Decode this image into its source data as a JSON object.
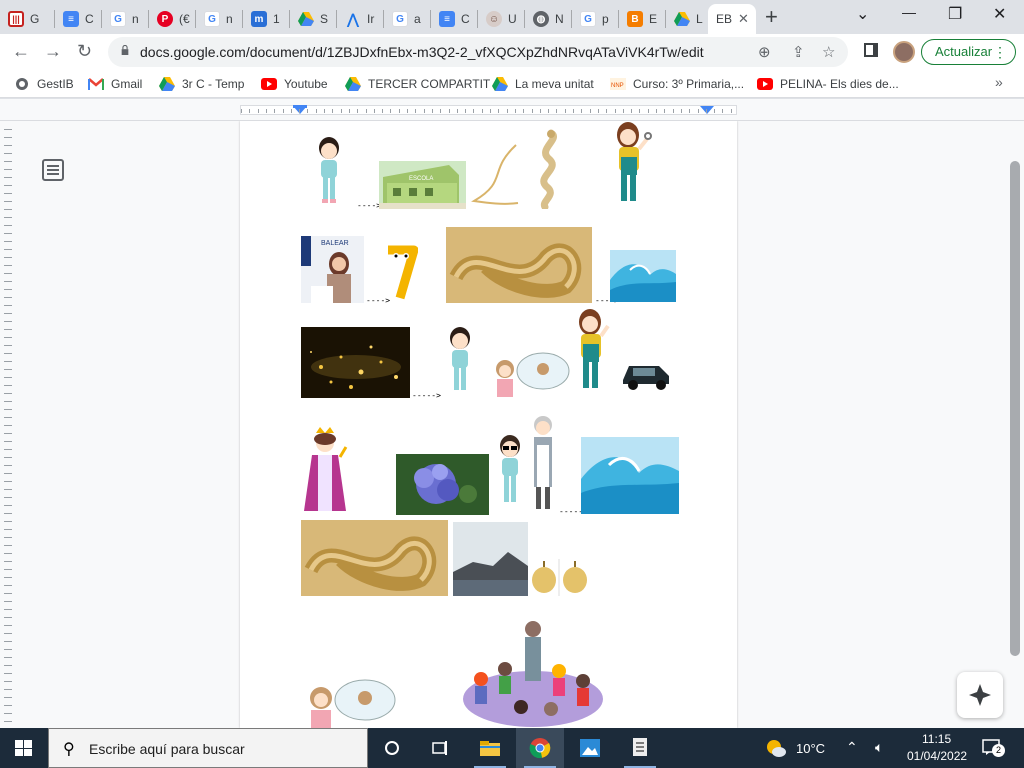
{
  "browser": {
    "tabs": [
      {
        "label": "G",
        "icon": "gestib-icon",
        "color": "#c5221f"
      },
      {
        "label": "C",
        "icon": "docs-icon",
        "color": "#4285f4"
      },
      {
        "label": "n",
        "icon": "google-icon",
        "color": "#4285f4"
      },
      {
        "label": "(€",
        "icon": "pinterest-icon",
        "color": "#e60023"
      },
      {
        "label": "n",
        "icon": "google-icon",
        "color": "#4285f4"
      },
      {
        "label": "1",
        "icon": "moodle-icon",
        "color": "#2a6fd6"
      },
      {
        "label": "S",
        "icon": "drive-icon",
        "color": "#0f9d58"
      },
      {
        "label": "Ir",
        "icon": "prism-icon",
        "color": "#1a73e8"
      },
      {
        "label": "a",
        "icon": "google-icon",
        "color": "#4285f4"
      },
      {
        "label": "C",
        "icon": "docs-icon",
        "color": "#4285f4"
      },
      {
        "label": "U",
        "icon": "avatar-icon",
        "color": "#9e7a5b"
      },
      {
        "label": "N",
        "icon": "globe-icon",
        "color": "#5f6368"
      },
      {
        "label": "p",
        "icon": "google-icon",
        "color": "#4285f4"
      },
      {
        "label": "E",
        "icon": "blogger-icon",
        "color": "#f57d00"
      },
      {
        "label": "L",
        "icon": "drive-icon",
        "color": "#0f9d58"
      },
      {
        "label": "EB",
        "icon": "docs-icon",
        "color": "#4285f4",
        "active": true
      }
    ],
    "new_tab_symbol": "+",
    "window_controls": {
      "minimize": "⌄",
      "restore": "—",
      "maximize": "❐",
      "close": "✕"
    },
    "url": "docs.google.com/document/d/1ZBJDxfnEbx-m3Q2-2_vfXQCXpZhdNRvqATaViVK4rTw/edit",
    "update_button": "Actualizar",
    "bookmarks": [
      {
        "label": "GestIB",
        "icon": "globe-icon"
      },
      {
        "label": "Gmail",
        "icon": "gmail-icon"
      },
      {
        "label": "3r C - Temp",
        "icon": "drive-icon"
      },
      {
        "label": "Youtube",
        "icon": "youtube-icon"
      },
      {
        "label": "TERCER COMPARTIT",
        "icon": "drive-icon"
      },
      {
        "label": "La meva unitat",
        "icon": "drive-icon"
      },
      {
        "label": "Curso: 3º Primaria,...",
        "icon": "course-icon"
      },
      {
        "label": "PELINA- Els dies de...",
        "icon": "youtube-icon"
      }
    ],
    "bookmarks_more": "»"
  },
  "document": {
    "arrow_text": "---->",
    "arrow_text_long": "----->",
    "images": [
      "girl-icon",
      "school-icon",
      "thread-icon",
      "snake-icon",
      "mechanic-icon",
      "speaker-icon",
      "number-seven-icon",
      "snake-photo",
      "wave-icon",
      "sparkles-photo",
      "girl-icon",
      "thinking-girl-icon",
      "mechanic-icon",
      "car-icon",
      "queen-icon",
      "hydrangea-photo",
      "girl-sunglasses-icon",
      "grandma-icon",
      "wave-icon",
      "snake-photo",
      "island-photo",
      "onion-photo",
      "thinking-girl-icon",
      "teacher-class-icon"
    ],
    "banner_text": "BALEAR",
    "school_sign": "ESCOLA"
  },
  "taskbar": {
    "search_placeholder": "Escribe aquí para buscar",
    "weather": "10°C",
    "time": "11:15",
    "date": "01/04/2022",
    "notifications": "2"
  }
}
